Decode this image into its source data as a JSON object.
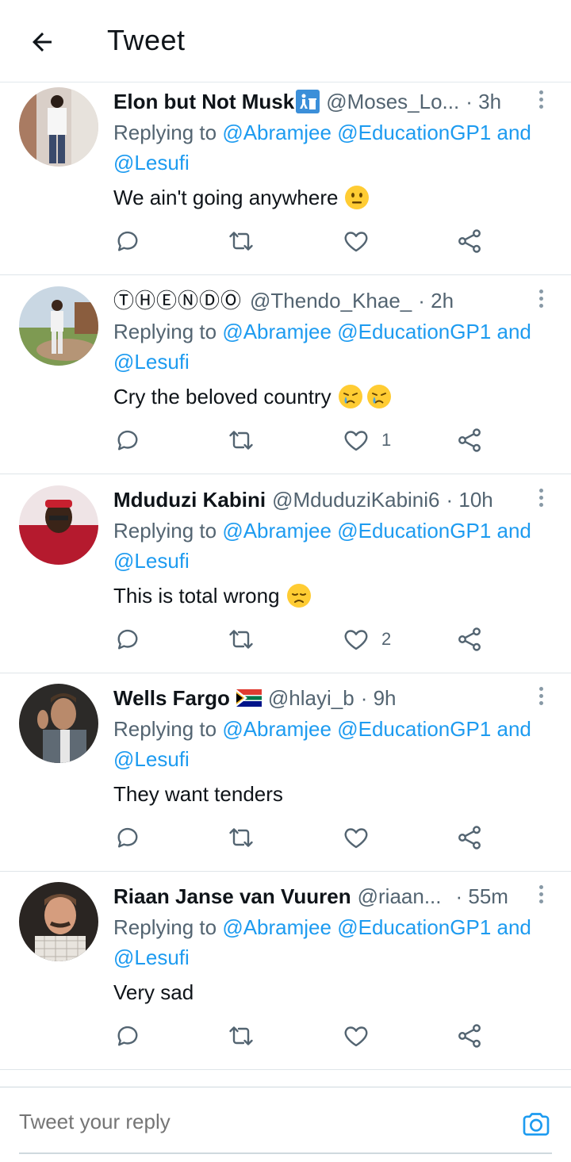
{
  "header": {
    "title": "Tweet"
  },
  "tweets": [
    {
      "name": "Elon but Not Musk",
      "name_extra": "trash-icon",
      "handle": "@Moses_Lo...",
      "time": "· 3h",
      "reply_prefix": "Replying to ",
      "mentions": [
        "@Abramjee",
        "@EducationGP1",
        "@Lesufi"
      ],
      "and_word": "and",
      "text": "We ain't going anywhere",
      "emoji": "neutral-face",
      "likes": ""
    },
    {
      "name": "ⓉⒽⒺⓃⒹⓄ",
      "name_extra": "",
      "handle": "@Thendo_Khae_",
      "time": "· 2h",
      "reply_prefix": "Replying to ",
      "mentions": [
        "@Abramjee",
        "@EducationGP1",
        "@Lesufi"
      ],
      "and_word": "and",
      "text": "Cry the beloved country",
      "emoji": "crying-face",
      "likes": "1"
    },
    {
      "name": "Mduduzi Kabini",
      "name_extra": "",
      "handle": "@MduduziKabini6",
      "time": "· 10h",
      "reply_prefix": "Replying to ",
      "mentions": [
        "@Abramjee",
        "@EducationGP1",
        "@Lesufi"
      ],
      "and_word": "and",
      "text": "This is total wrong",
      "emoji": "disappointed-face",
      "likes": "2"
    },
    {
      "name": "Wells Fargo",
      "name_extra": "south-africa-flag",
      "handle": "@hlayi_b",
      "time": "· 9h",
      "reply_prefix": "Replying to ",
      "mentions": [
        "@Abramjee",
        "@EducationGP1",
        "@Lesufi"
      ],
      "and_word": "and",
      "text": "They want tenders",
      "emoji": "",
      "likes": ""
    },
    {
      "name": "Riaan Janse van Vuuren",
      "name_extra": "",
      "handle": "@riaan...",
      "time": "· 55m",
      "reply_prefix": "Replying to ",
      "mentions": [
        "@Abramjee",
        "@EducationGP1",
        "@Lesufi"
      ],
      "and_word": "and",
      "text": "Very sad",
      "emoji": "",
      "likes": ""
    }
  ],
  "composer": {
    "placeholder": "Tweet your reply"
  },
  "colors": {
    "accent": "#1d9bf0",
    "muted": "#536471",
    "text": "#0f1419",
    "divider": "#e1e8ed"
  }
}
